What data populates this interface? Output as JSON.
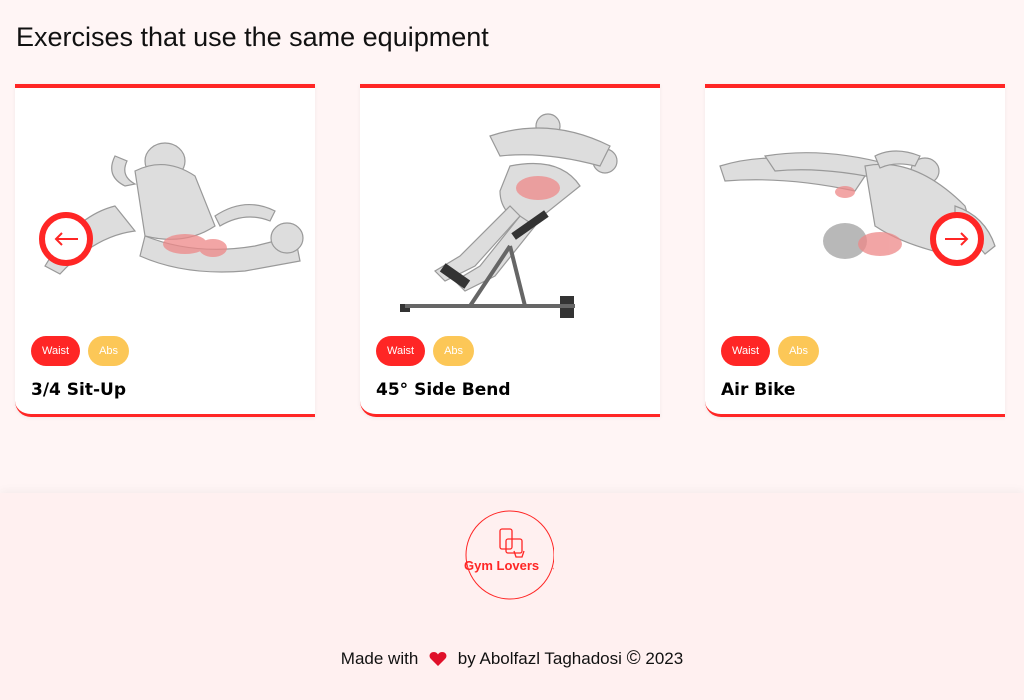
{
  "section": {
    "title": "Exercises that use the same equipment"
  },
  "cards": [
    {
      "name": "3/4 Sit-Up",
      "tags": [
        "Waist",
        "Abs"
      ]
    },
    {
      "name": "45° Side Bend",
      "tags": [
        "Waist",
        "Abs"
      ]
    },
    {
      "name": "Air Bike",
      "tags": [
        "Waist",
        "Abs"
      ]
    }
  ],
  "nav": {
    "prev_icon": "arrow-left-icon",
    "next_icon": "arrow-right-icon"
  },
  "footer": {
    "logo_text": "Gym Lovers",
    "made_with": "Made with",
    "by": "by Abolfazl Taghadosi",
    "copyright": "©",
    "year": "2023"
  },
  "colors": {
    "accent": "#ff2625",
    "tag_secondary": "#fcc757",
    "footer_bg": "#fff0f0"
  }
}
